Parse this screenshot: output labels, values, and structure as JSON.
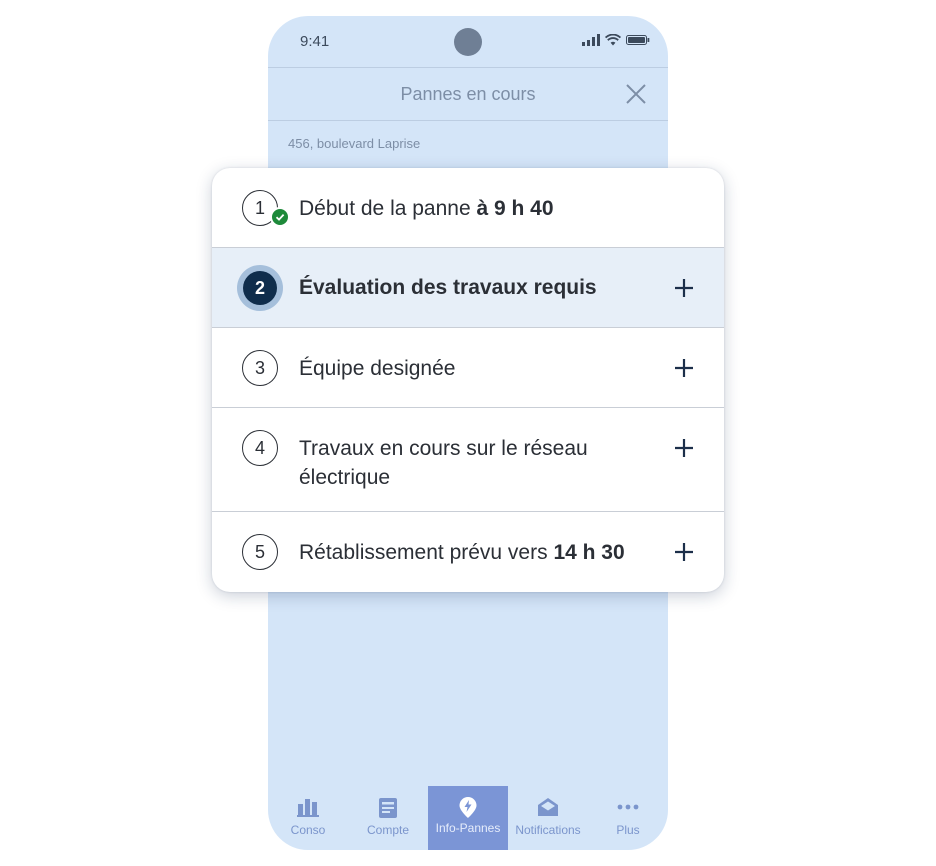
{
  "status_bar": {
    "time": "9:41"
  },
  "header": {
    "title": "Pannes en cours",
    "close_icon": "close-icon"
  },
  "address": "456, boulevard Laprise",
  "steps": [
    {
      "number": "1",
      "text": "Début de la panne ",
      "bold": "à 9 h 40",
      "state": "done",
      "expandable": false
    },
    {
      "number": "2",
      "text": "Évaluation des travaux requis",
      "bold": "",
      "state": "active",
      "expandable": true
    },
    {
      "number": "3",
      "text": "Équipe designée",
      "bold": "",
      "state": "pending",
      "expandable": true
    },
    {
      "number": "4",
      "text": "Travaux en cours sur le réseau électrique",
      "bold": "",
      "state": "pending",
      "expandable": true
    },
    {
      "number": "5",
      "text": "Rétablissement prévu vers ",
      "bold": "14 h 30",
      "state": "pending",
      "expandable": true
    }
  ],
  "tabs": [
    {
      "label": "Conso",
      "icon": "bar-chart-icon",
      "active": false
    },
    {
      "label": "Compte",
      "icon": "bill-icon",
      "active": false
    },
    {
      "label": "Info-Pannes",
      "icon": "lightning-pin-icon",
      "active": true
    },
    {
      "label": "Notifications",
      "icon": "envelope-icon",
      "active": false
    },
    {
      "label": "Plus",
      "icon": "more-dots-icon",
      "active": false
    }
  ],
  "colors": {
    "phone_bg": "#d4e5f8",
    "active_tab": "#7b95d6",
    "active_step_bg": "#e7eff8",
    "active_number_bg": "#0f2d4c",
    "check_green": "#1e8a3a",
    "text_dark": "#2b2f36"
  }
}
